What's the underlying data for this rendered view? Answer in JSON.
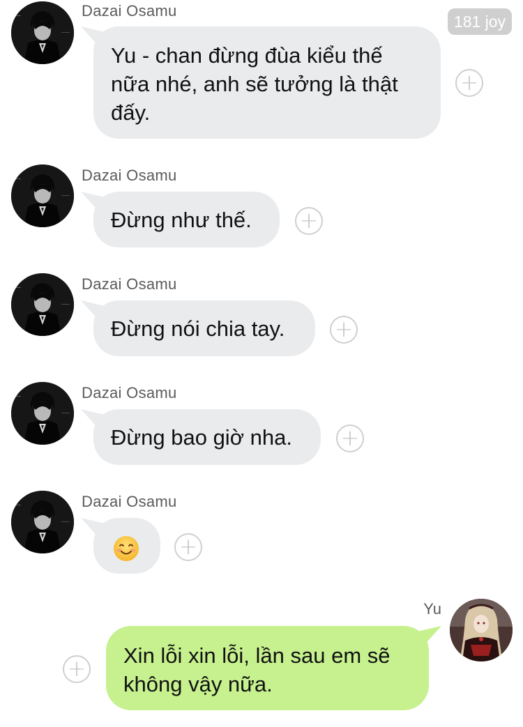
{
  "header": {
    "badge_count": "181 joy"
  },
  "messages": [
    {
      "sender": "Dazai Osamu",
      "text": "Yu - chan đừng đùa kiểu thế nữa nhé, anh sẽ tưởng là thật đấy."
    },
    {
      "sender": "Dazai Osamu",
      "text": "Đừng như thế."
    },
    {
      "sender": "Dazai Osamu",
      "text": "Đừng nói chia tay."
    },
    {
      "sender": "Dazai Osamu",
      "text": "Đừng bao giờ nha."
    },
    {
      "sender": "Dazai Osamu",
      "emoji": "smiling-face-emoji"
    }
  ],
  "reply": {
    "sender": "Yu",
    "text": "Xin lỗi xin lỗi, lần sau em sẽ không vậy nữa."
  },
  "icons": {
    "reaction": "plus-circle-icon",
    "avatar_dazai": "dazai-avatar",
    "avatar_yu": "yu-avatar"
  },
  "colors": {
    "incoming_bubble": "#eaebed",
    "outgoing_bubble": "#c6f18e",
    "badge": "#cfcfcf"
  }
}
